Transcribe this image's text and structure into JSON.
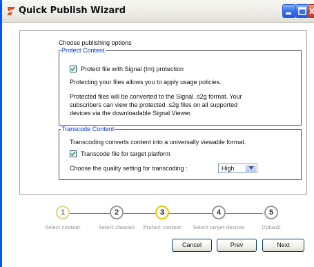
{
  "window": {
    "title": "Quick Publish Wizard"
  },
  "options": {
    "heading": "Choose publishing options",
    "protect": {
      "legend": "Protect Content",
      "checkbox_label": "Protect file with Signal (tm) protection",
      "checked": true,
      "text1": "Protecting your files allows you to apply usage policies.",
      "text2_line1": "Protected files will be converted to the Signal .s2g format. Your",
      "text2_line2": "subscribers can view the protected .s2g files on all supported",
      "text2_line3": "devices via the downloadable Signal Viewer."
    },
    "transcode": {
      "legend": "Transcode Content",
      "text": "Transcoding converts content into a universally viewable format.",
      "checkbox_label": "Transcode file for target platform",
      "checked": true,
      "quality_label": "Choose the quality setting for transcoding :",
      "quality_value": "High"
    }
  },
  "steps": [
    {
      "number": "1",
      "label": "Select content",
      "state": "done"
    },
    {
      "number": "2",
      "label": "Select channel",
      "state": "pending"
    },
    {
      "number": "3",
      "label": "Protect content",
      "state": "current"
    },
    {
      "number": "4",
      "label": "Select target devices",
      "state": "pending"
    },
    {
      "number": "5",
      "label": "Upload!",
      "state": "pending"
    }
  ],
  "buttons": {
    "cancel": "Cancel",
    "prev": "Prev",
    "next": "Next"
  },
  "colors": {
    "legend": "#0033cc",
    "current_step": "#f5c400",
    "titlebar_accent": "#0058ee"
  }
}
